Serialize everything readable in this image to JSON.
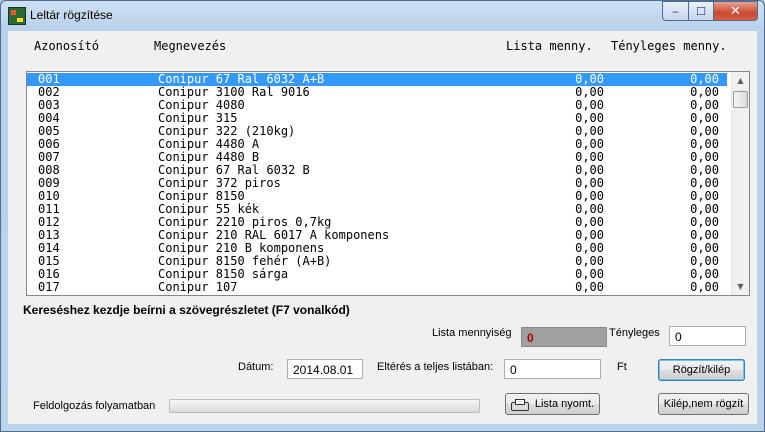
{
  "window": {
    "title": "Leltár rögzítése",
    "minimize": "‒",
    "maximize": "☐",
    "close": "✕"
  },
  "columns": {
    "id": "Azonosító",
    "name": "Megnevezés",
    "lista": "Lista menny.",
    "tenyleges": "Tényleges menny."
  },
  "rows": [
    {
      "id": "001",
      "name": "Conipur 67 Ral 6032 A+B",
      "lista": "0,00",
      "tenyleges": "0,00"
    },
    {
      "id": "002",
      "name": "Conipur 3100 Ral 9016",
      "lista": "0,00",
      "tenyleges": "0,00"
    },
    {
      "id": "003",
      "name": "Conipur 4080",
      "lista": "0,00",
      "tenyleges": "0,00"
    },
    {
      "id": "004",
      "name": "Conipur 315",
      "lista": "0,00",
      "tenyleges": "0,00"
    },
    {
      "id": "005",
      "name": "Conipur 322 (210kg)",
      "lista": "0,00",
      "tenyleges": "0,00"
    },
    {
      "id": "006",
      "name": "Conipur 4480 A",
      "lista": "0,00",
      "tenyleges": "0,00"
    },
    {
      "id": "007",
      "name": "Conipur 4480 B",
      "lista": "0,00",
      "tenyleges": "0,00"
    },
    {
      "id": "008",
      "name": "Conipur 67 Ral 6032 B",
      "lista": "0,00",
      "tenyleges": "0,00"
    },
    {
      "id": "009",
      "name": "Conipur 372 piros",
      "lista": "0,00",
      "tenyleges": "0,00"
    },
    {
      "id": "010",
      "name": "Conipur 8150",
      "lista": "0,00",
      "tenyleges": "0,00"
    },
    {
      "id": "011",
      "name": "Conipur 55 kék",
      "lista": "0,00",
      "tenyleges": "0,00"
    },
    {
      "id": "012",
      "name": "Conipur 2210 piros 0,7kg",
      "lista": "0,00",
      "tenyleges": "0,00"
    },
    {
      "id": "013",
      "name": "Conipur 210 RAL 6017 A komponens",
      "lista": "0,00",
      "tenyleges": "0,00"
    },
    {
      "id": "014",
      "name": "Conipur 210 B komponens",
      "lista": "0,00",
      "tenyleges": "0,00"
    },
    {
      "id": "015",
      "name": "Conipur 8150 fehér (A+B)",
      "lista": "0,00",
      "tenyleges": "0,00"
    },
    {
      "id": "016",
      "name": "Conipur 8150 sárga",
      "lista": "0,00",
      "tenyleges": "0,00"
    },
    {
      "id": "017",
      "name": "Conipur 107",
      "lista": "0,00",
      "tenyleges": "0,00"
    }
  ],
  "selected_row_index": 0,
  "search_hint": "Kereséshez kezdje beírni a szövegrészletet (F7 vonalkód)",
  "form": {
    "lista_label": "Lista mennyiség",
    "lista_value": "0",
    "tenyleges_label": "Tényleges",
    "tenyleges_value": "0",
    "datum_label": "Dátum:",
    "datum_value": "2014.08.01",
    "elteres_label": "Eltérés a teljes listában:",
    "elteres_value": "0",
    "unit": "Ft"
  },
  "buttons": {
    "rogzit": "Rögzít/kilép",
    "lista_nyomt": "Lista nyomt.",
    "kilep": "Kilép,nem rögzít"
  },
  "status": {
    "label": "Feldolgozás folyamatban",
    "progress": 0
  },
  "colors": {
    "selection": "#3399ff",
    "readonly_value": "#b00000",
    "progress": "#06b025"
  },
  "icons": {
    "app": "app-icon",
    "print": "printer-icon"
  }
}
